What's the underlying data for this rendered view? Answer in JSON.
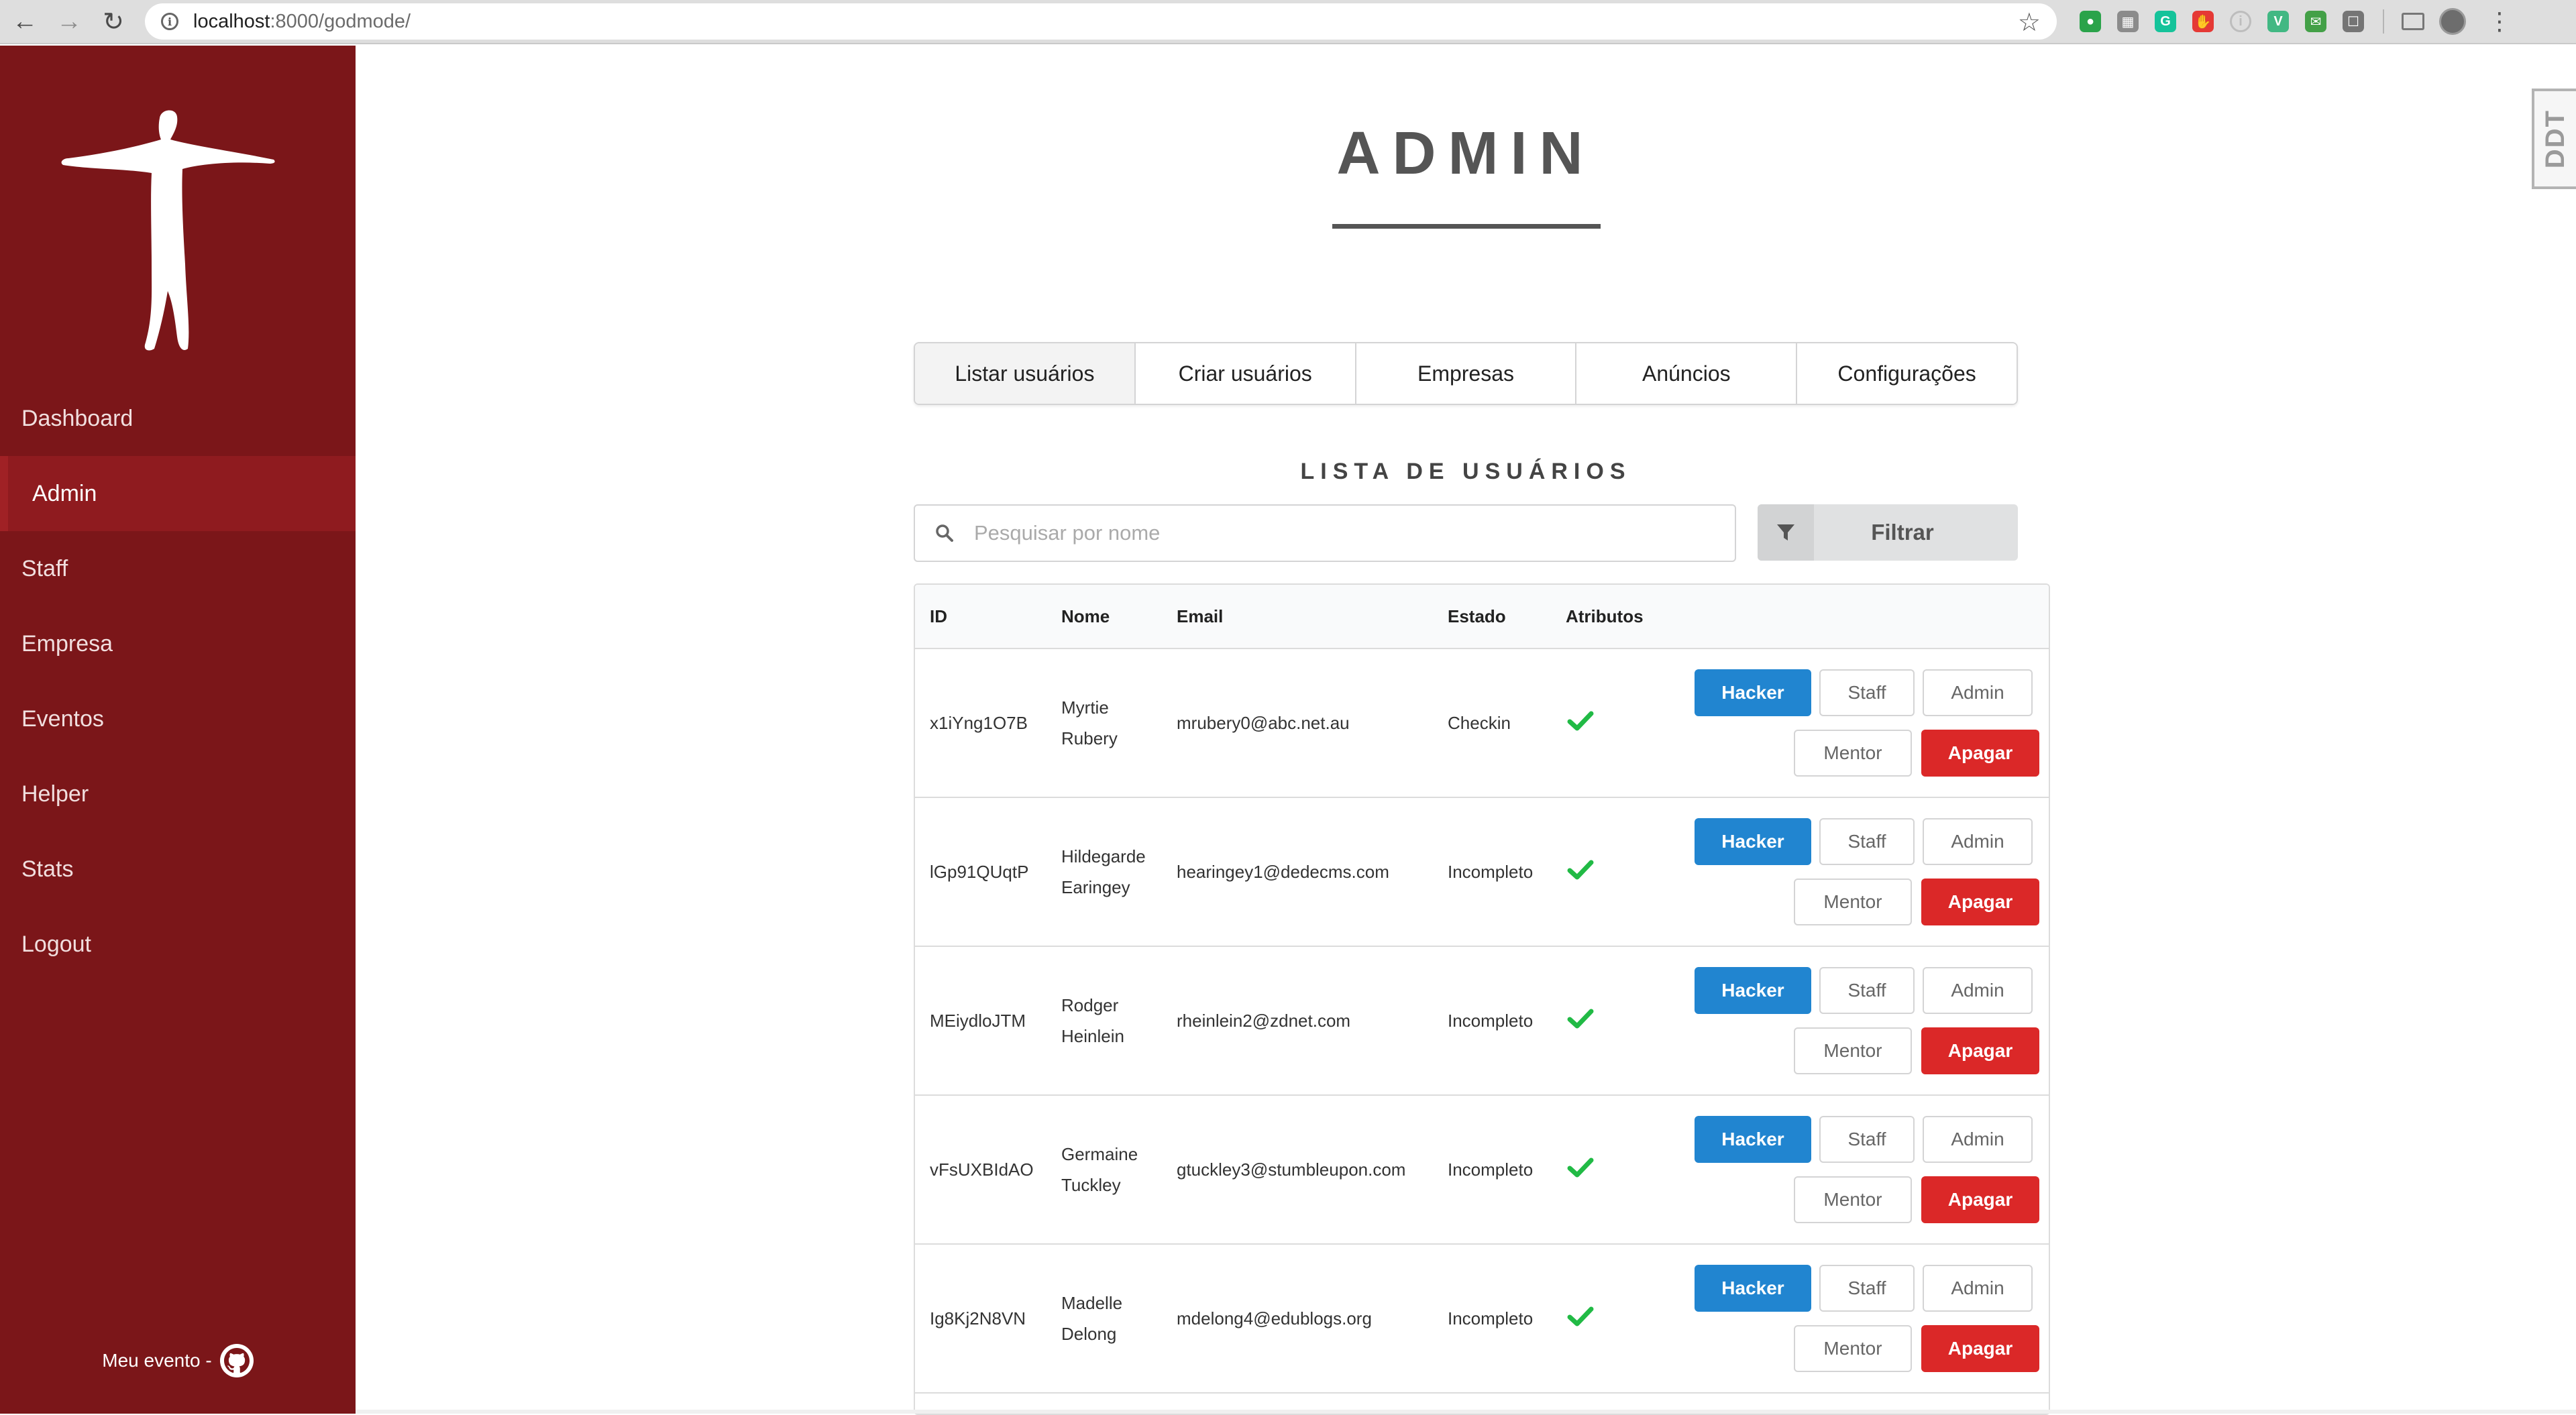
{
  "browser": {
    "url_host": "localhost",
    "url_rest": ":8000/godmode/",
    "extensions": [
      {
        "name": "ext-green-icon",
        "color": "#2aa34a",
        "glyph": "●"
      },
      {
        "name": "ext-gray-icon",
        "color": "#8b8b8b",
        "glyph": "▦"
      },
      {
        "name": "grammarly-icon",
        "color": "#15c39a",
        "glyph": "G"
      },
      {
        "name": "ext-red-icon",
        "color": "#e53935",
        "glyph": "✋"
      },
      {
        "name": "ext-info-icon",
        "color": "#bdbdbd",
        "glyph": "i"
      },
      {
        "name": "vue-devtools-icon",
        "color": "#41b883",
        "glyph": "V"
      },
      {
        "name": "ext-mail-icon",
        "color": "#43a047",
        "glyph": "✉"
      },
      {
        "name": "ext-box-icon",
        "color": "#757575",
        "glyph": "☐"
      }
    ]
  },
  "sidebar": {
    "items": [
      {
        "label": "Dashboard"
      },
      {
        "label": "Admin"
      },
      {
        "label": "Staff"
      },
      {
        "label": "Empresa"
      },
      {
        "label": "Eventos"
      },
      {
        "label": "Helper"
      },
      {
        "label": "Stats"
      },
      {
        "label": "Logout"
      }
    ],
    "active_index": 1,
    "footer_text": "Meu evento -"
  },
  "page": {
    "title": "ADMIN",
    "badge": "DDT"
  },
  "tabs": [
    {
      "label": "Listar usuários",
      "active": true
    },
    {
      "label": "Criar usuários",
      "active": false
    },
    {
      "label": "Empresas",
      "active": false
    },
    {
      "label": "Anúncios",
      "active": false
    },
    {
      "label": "Configurações",
      "active": false
    }
  ],
  "list": {
    "title": "LISTA DE USUÁRIOS",
    "search_placeholder": "Pesquisar por nome",
    "filter_label": "Filtrar"
  },
  "table": {
    "columns": [
      "ID",
      "Nome",
      "Email",
      "Estado",
      "Atributos"
    ],
    "actions": {
      "hacker": "Hacker",
      "staff": "Staff",
      "admin": "Admin",
      "mentor": "Mentor",
      "delete": "Apagar"
    },
    "rows": [
      {
        "id": "x1iYng1O7B",
        "first": "Myrtie",
        "last": "Rubery",
        "email": "mrubery0@abc.net.au",
        "status": "Checkin"
      },
      {
        "id": "lGp91QUqtP",
        "first": "Hildegarde",
        "last": "Earingey",
        "email": "hearingey1@dedecms.com",
        "status": "Incompleto"
      },
      {
        "id": "MEiydloJTM",
        "first": "Rodger",
        "last": "Heinlein",
        "email": "rheinlein2@zdnet.com",
        "status": "Incompleto"
      },
      {
        "id": "vFsUXBIdAO",
        "first": "Germaine",
        "last": "Tuckley",
        "email": "gtuckley3@stumbleupon.com",
        "status": "Incompleto"
      },
      {
        "id": "Ig8Kj2N8VN",
        "first": "Madelle",
        "last": "Delong",
        "email": "mdelong4@edublogs.org",
        "status": "Incompleto"
      }
    ]
  },
  "colors": {
    "sidebar": "#7b1619",
    "sidebar_active": "#8f1b1f",
    "primary_blue": "#2185d0",
    "danger_red": "#db2828",
    "check_green": "#21ba45"
  }
}
